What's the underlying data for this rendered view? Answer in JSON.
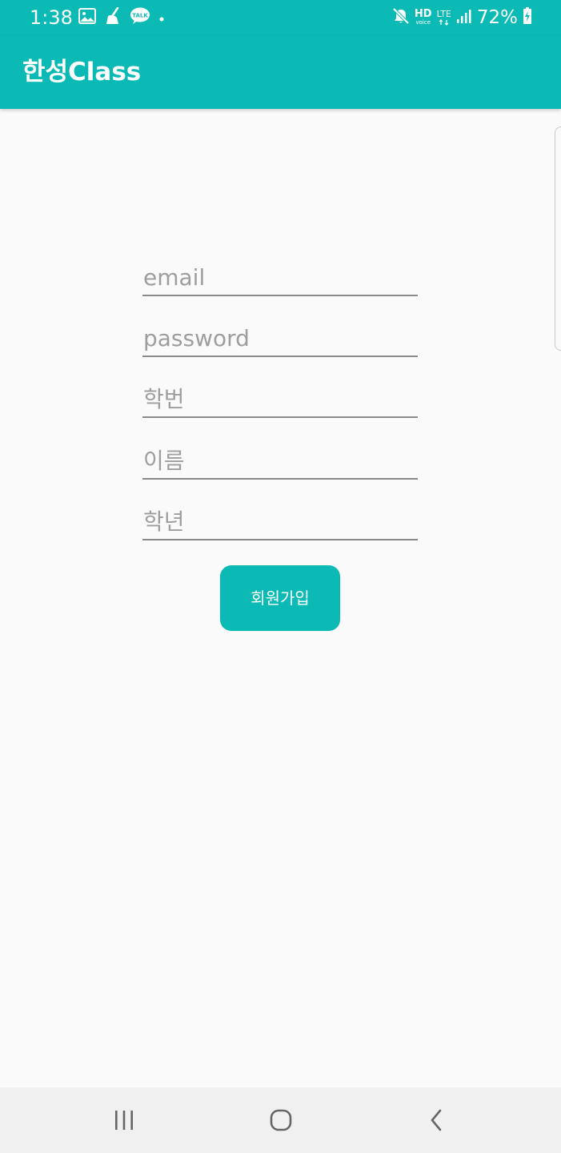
{
  "status_bar": {
    "time": "1:38",
    "left_icons": [
      "gallery-icon",
      "cleaner-icon",
      "kakaotalk-icon",
      "notification-dot-icon"
    ],
    "kakaotalk_badge": "TALK",
    "hd_label": "HD",
    "hd_sub_label": "voice",
    "lte_label": "LTE",
    "battery_percent": "72%",
    "right_icons": [
      "mute-icon",
      "hd-voice-icon",
      "lte-icon",
      "signal-icon",
      "battery-charging-icon"
    ]
  },
  "app_bar": {
    "title": "한성Class",
    "color": "#0bbab5"
  },
  "form": {
    "email": {
      "placeholder": "email",
      "value": ""
    },
    "password": {
      "placeholder": "password",
      "value": ""
    },
    "student_id": {
      "placeholder": "학번",
      "value": ""
    },
    "name": {
      "placeholder": "이름",
      "value": ""
    },
    "grade": {
      "placeholder": "학년",
      "value": ""
    },
    "signup_label": "회원가입"
  },
  "nav_bar": {
    "buttons": [
      "recent-apps-icon",
      "home-icon",
      "back-icon"
    ]
  }
}
